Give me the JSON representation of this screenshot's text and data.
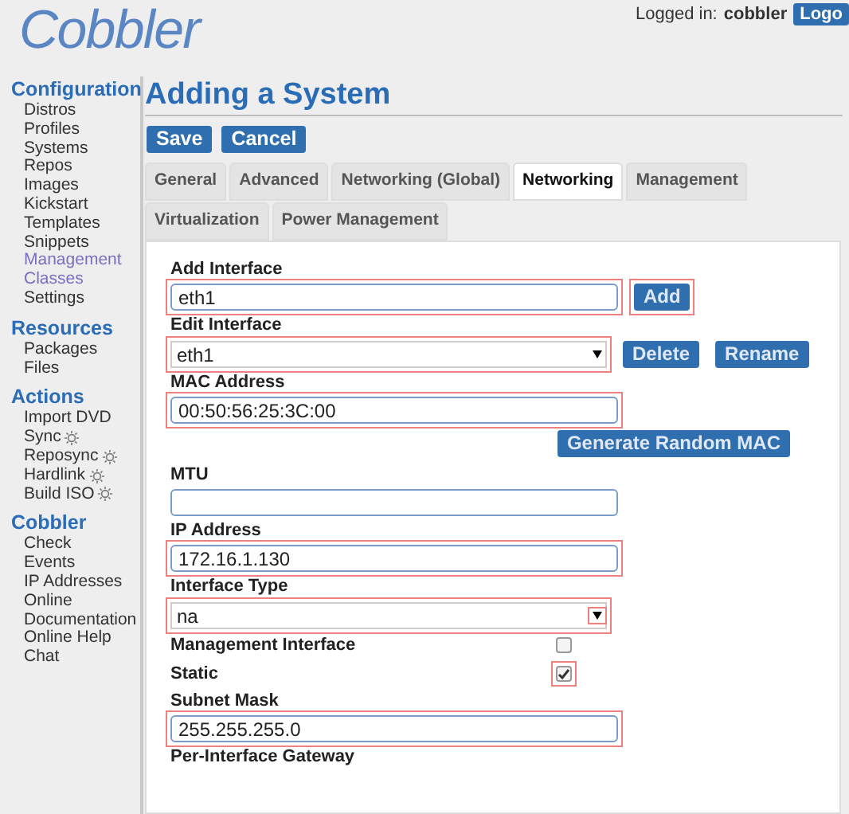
{
  "header": {
    "logo": "Cobbler",
    "logged_in_label": "Logged in:",
    "user": "cobbler",
    "logout": "Logo"
  },
  "sidebar": [
    {
      "heading": "Configuration",
      "items": [
        {
          "label": "Distros",
          "visited": false,
          "busy": false
        },
        {
          "label": "Profiles",
          "visited": false,
          "busy": false
        },
        {
          "label": "Systems",
          "visited": false,
          "busy": false
        },
        {
          "label": "Repos",
          "visited": false,
          "busy": false
        },
        {
          "label": "Images",
          "visited": false,
          "busy": false
        },
        {
          "label": "Kickstart",
          "visited": false,
          "busy": false
        },
        {
          "label": "Templates",
          "visited": false,
          "busy": false
        },
        {
          "label": "Snippets",
          "visited": false,
          "busy": false
        },
        {
          "label": "Management",
          "visited": true,
          "busy": false
        },
        {
          "label": "Classes",
          "visited": true,
          "busy": false
        },
        {
          "label": "Settings",
          "visited": false,
          "busy": false
        }
      ]
    },
    {
      "heading": "Resources",
      "items": [
        {
          "label": "Packages",
          "visited": false,
          "busy": false
        },
        {
          "label": "Files",
          "visited": false,
          "busy": false
        }
      ]
    },
    {
      "heading": "Actions",
      "items": [
        {
          "label": "Import DVD",
          "visited": false,
          "busy": false
        },
        {
          "label": "Sync",
          "visited": false,
          "busy": true
        },
        {
          "label": "Reposync",
          "visited": false,
          "busy": true
        },
        {
          "label": "Hardlink",
          "visited": false,
          "busy": true
        },
        {
          "label": "Build ISO",
          "visited": false,
          "busy": true
        }
      ]
    },
    {
      "heading": "Cobbler",
      "items": [
        {
          "label": "Check",
          "visited": false,
          "busy": false
        },
        {
          "label": "Events",
          "visited": false,
          "busy": false
        },
        {
          "label": "IP Addresses",
          "visited": false,
          "busy": false
        },
        {
          "label": "Online",
          "visited": false,
          "busy": false
        },
        {
          "label": "Documentation",
          "visited": false,
          "busy": false
        },
        {
          "label": "Online Help",
          "visited": false,
          "busy": false
        },
        {
          "label": "Chat",
          "visited": false,
          "busy": false
        }
      ]
    }
  ],
  "title": "Adding a System",
  "actions": [
    "Save",
    "Cancel"
  ],
  "tab_rows": [
    [
      {
        "label": "General",
        "selected": false
      },
      {
        "label": "Advanced",
        "selected": false
      },
      {
        "label": "Networking (Global)",
        "selected": false
      },
      {
        "label": "Networking",
        "selected": true
      },
      {
        "label": "Management",
        "selected": false
      }
    ],
    [
      {
        "label": "Virtualization",
        "selected": false
      },
      {
        "label": "Power Management",
        "selected": false
      }
    ]
  ],
  "fields": [
    {
      "kind": "text",
      "label": "Add Interface",
      "value": "eth1",
      "highlighted": true,
      "buttons": [
        {
          "label": "Add",
          "highlighted": true
        }
      ]
    },
    {
      "kind": "select",
      "label": "Edit Interface",
      "value": "eth1",
      "highlighted": true,
      "arrow_highlighted": false,
      "buttons": [
        {
          "label": "Delete",
          "highlighted": false
        },
        {
          "label": "Rename",
          "highlighted": false
        }
      ]
    },
    {
      "kind": "text",
      "label": "MAC Address",
      "value": "00:50:56:25:3C:00",
      "highlighted": true
    },
    {
      "kind": "button",
      "buttons": [
        {
          "label": "Generate Random MAC",
          "highlighted": false
        }
      ]
    },
    {
      "kind": "text",
      "label": "MTU",
      "highlighted": false
    },
    {
      "kind": "text",
      "label": "IP Address",
      "value": "172.16.1.130",
      "highlighted": true
    },
    {
      "kind": "select",
      "label": "Interface Type",
      "value": "na",
      "highlighted": true,
      "arrow_highlighted": true
    },
    {
      "kind": "checkbox",
      "label": "Management Interface",
      "checked": false,
      "highlighted": false
    },
    {
      "kind": "checkbox",
      "label": "Static",
      "checked": true,
      "highlighted": true
    },
    {
      "kind": "text",
      "label": "Subnet Mask",
      "value": "255.255.255.0",
      "highlighted": true
    },
    {
      "kind": "heading",
      "label": "Per-Interface Gateway"
    }
  ]
}
